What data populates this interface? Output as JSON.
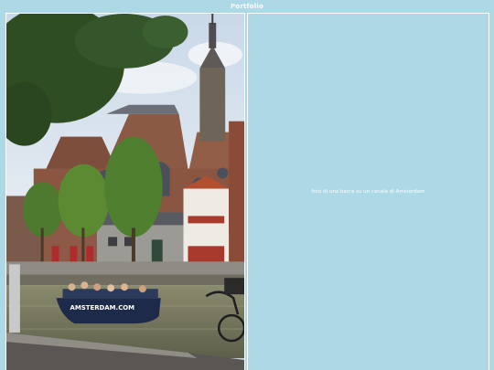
{
  "window": {
    "title": "Portfolio"
  },
  "image": {
    "alt": "foto di una barca su un canale di Amsterdam",
    "boat_sign": "AMSTERDAM.COM"
  },
  "caption": {
    "text": "foto di una barca su un canale di Amsterdam"
  },
  "colors": {
    "background": "#add8e6",
    "border": "#ffffff",
    "text": "#ffffff"
  }
}
